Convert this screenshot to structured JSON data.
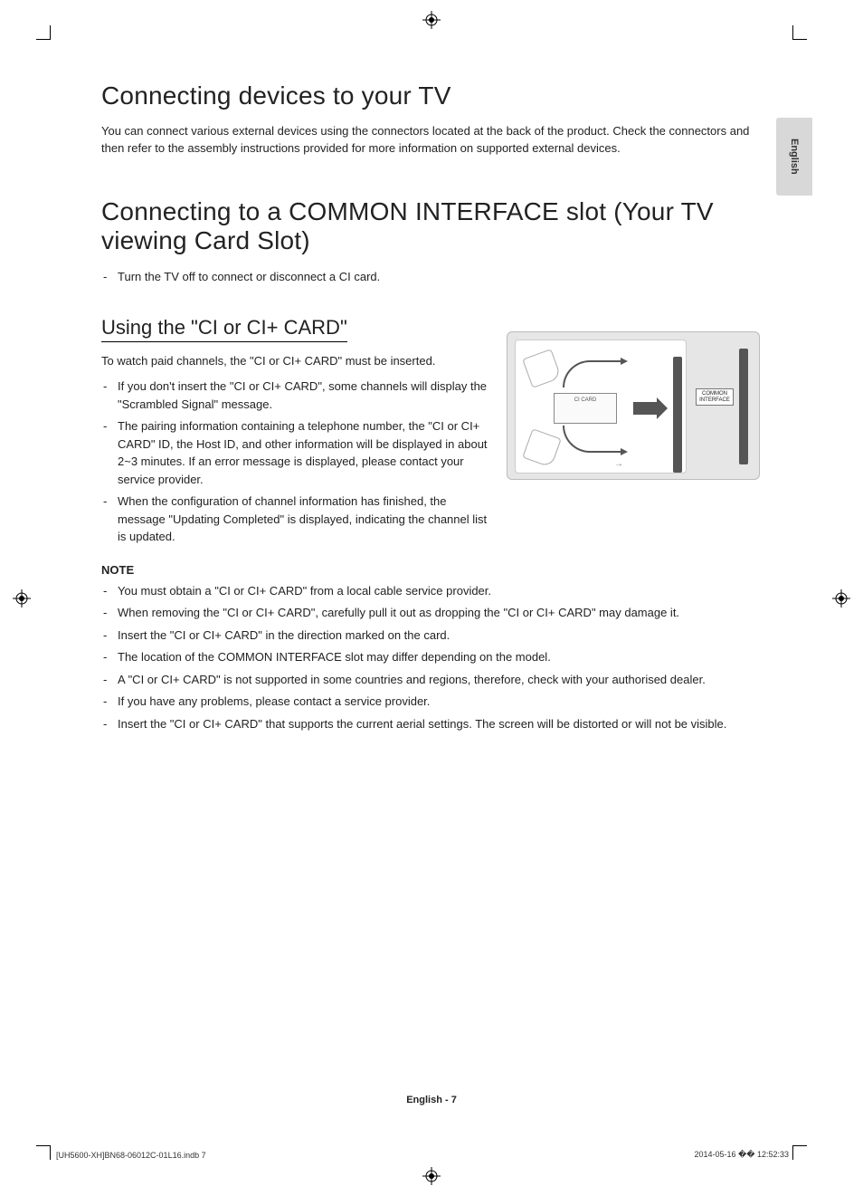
{
  "lang_tab": "English",
  "h1_a": "Connecting devices to your TV",
  "intro_a": "You can connect various external devices using the connectors located at the back of the product. Check the connectors and then refer to the assembly instructions provided for more information on supported external devices.",
  "h1_b": "Connecting to a COMMON INTERFACE slot (Your TV viewing Card Slot)",
  "list_b": {
    "0": "Turn the TV off to connect or disconnect a CI card."
  },
  "h2_c": "Using the \"CI or CI+ CARD\"",
  "intro_c": "To watch paid channels, the \"CI or CI+ CARD\" must be inserted.",
  "list_c": {
    "0": "If you don't insert the \"CI or CI+ CARD\", some channels will display the \"Scrambled Signal\" message.",
    "1": "The pairing information containing a telephone number, the \"CI or CI+ CARD\" ID, the Host ID, and other information will be displayed in about 2~3 minutes. If an error message is displayed, please contact your service provider.",
    "2": "When the configuration of channel information has finished, the message \"Updating Completed\" is displayed, indicating the channel list is updated."
  },
  "note_heading": "NOTE",
  "list_note": {
    "0": "You must obtain a \"CI or CI+ CARD\" from a local cable service provider.",
    "1": "When removing the \"CI or CI+ CARD\", carefully pull it out as dropping the \"CI or CI+ CARD\" may damage it.",
    "2": "Insert the \"CI or CI+ CARD\" in the direction marked on the card.",
    "3": "The location of the COMMON INTERFACE slot may differ depending on the model.",
    "4": "A \"CI or CI+ CARD\" is not supported in some countries and regions, therefore, check with your authorised dealer.",
    "5": "If you have any problems, please contact a service provider.",
    "6": "Insert the \"CI or CI+ CARD\" that supports the current aerial settings. The screen will be distorted or will not be visible."
  },
  "diagram": {
    "card_label": "CI CARD",
    "slot_label": "COMMON INTERFACE"
  },
  "footer": "English - 7",
  "print_left": "[UH5600-XH]BN68-06012C-01L16.indb   7",
  "print_right": "2014-05-16   �� 12:52:33"
}
